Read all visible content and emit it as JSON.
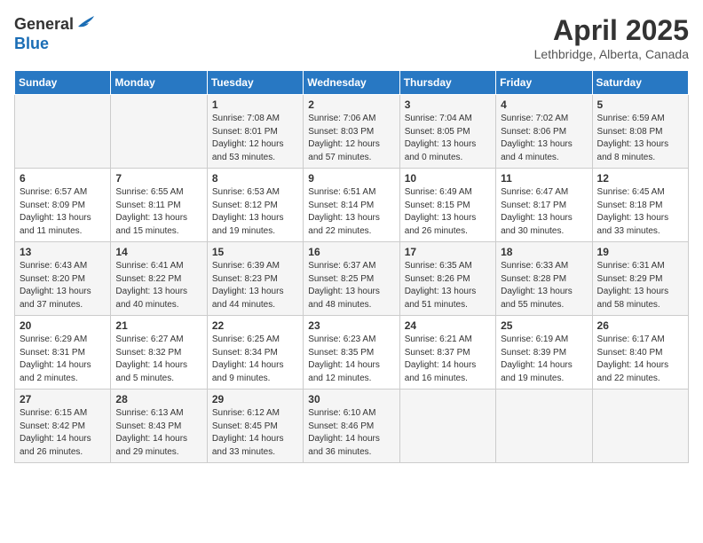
{
  "header": {
    "logo_general": "General",
    "logo_blue": "Blue",
    "month": "April 2025",
    "location": "Lethbridge, Alberta, Canada"
  },
  "days_of_week": [
    "Sunday",
    "Monday",
    "Tuesday",
    "Wednesday",
    "Thursday",
    "Friday",
    "Saturday"
  ],
  "weeks": [
    [
      {
        "day": "",
        "sunrise": "",
        "sunset": "",
        "daylight": ""
      },
      {
        "day": "",
        "sunrise": "",
        "sunset": "",
        "daylight": ""
      },
      {
        "day": "1",
        "sunrise": "Sunrise: 7:08 AM",
        "sunset": "Sunset: 8:01 PM",
        "daylight": "Daylight: 12 hours and 53 minutes."
      },
      {
        "day": "2",
        "sunrise": "Sunrise: 7:06 AM",
        "sunset": "Sunset: 8:03 PM",
        "daylight": "Daylight: 12 hours and 57 minutes."
      },
      {
        "day": "3",
        "sunrise": "Sunrise: 7:04 AM",
        "sunset": "Sunset: 8:05 PM",
        "daylight": "Daylight: 13 hours and 0 minutes."
      },
      {
        "day": "4",
        "sunrise": "Sunrise: 7:02 AM",
        "sunset": "Sunset: 8:06 PM",
        "daylight": "Daylight: 13 hours and 4 minutes."
      },
      {
        "day": "5",
        "sunrise": "Sunrise: 6:59 AM",
        "sunset": "Sunset: 8:08 PM",
        "daylight": "Daylight: 13 hours and 8 minutes."
      }
    ],
    [
      {
        "day": "6",
        "sunrise": "Sunrise: 6:57 AM",
        "sunset": "Sunset: 8:09 PM",
        "daylight": "Daylight: 13 hours and 11 minutes."
      },
      {
        "day": "7",
        "sunrise": "Sunrise: 6:55 AM",
        "sunset": "Sunset: 8:11 PM",
        "daylight": "Daylight: 13 hours and 15 minutes."
      },
      {
        "day": "8",
        "sunrise": "Sunrise: 6:53 AM",
        "sunset": "Sunset: 8:12 PM",
        "daylight": "Daylight: 13 hours and 19 minutes."
      },
      {
        "day": "9",
        "sunrise": "Sunrise: 6:51 AM",
        "sunset": "Sunset: 8:14 PM",
        "daylight": "Daylight: 13 hours and 22 minutes."
      },
      {
        "day": "10",
        "sunrise": "Sunrise: 6:49 AM",
        "sunset": "Sunset: 8:15 PM",
        "daylight": "Daylight: 13 hours and 26 minutes."
      },
      {
        "day": "11",
        "sunrise": "Sunrise: 6:47 AM",
        "sunset": "Sunset: 8:17 PM",
        "daylight": "Daylight: 13 hours and 30 minutes."
      },
      {
        "day": "12",
        "sunrise": "Sunrise: 6:45 AM",
        "sunset": "Sunset: 8:18 PM",
        "daylight": "Daylight: 13 hours and 33 minutes."
      }
    ],
    [
      {
        "day": "13",
        "sunrise": "Sunrise: 6:43 AM",
        "sunset": "Sunset: 8:20 PM",
        "daylight": "Daylight: 13 hours and 37 minutes."
      },
      {
        "day": "14",
        "sunrise": "Sunrise: 6:41 AM",
        "sunset": "Sunset: 8:22 PM",
        "daylight": "Daylight: 13 hours and 40 minutes."
      },
      {
        "day": "15",
        "sunrise": "Sunrise: 6:39 AM",
        "sunset": "Sunset: 8:23 PM",
        "daylight": "Daylight: 13 hours and 44 minutes."
      },
      {
        "day": "16",
        "sunrise": "Sunrise: 6:37 AM",
        "sunset": "Sunset: 8:25 PM",
        "daylight": "Daylight: 13 hours and 48 minutes."
      },
      {
        "day": "17",
        "sunrise": "Sunrise: 6:35 AM",
        "sunset": "Sunset: 8:26 PM",
        "daylight": "Daylight: 13 hours and 51 minutes."
      },
      {
        "day": "18",
        "sunrise": "Sunrise: 6:33 AM",
        "sunset": "Sunset: 8:28 PM",
        "daylight": "Daylight: 13 hours and 55 minutes."
      },
      {
        "day": "19",
        "sunrise": "Sunrise: 6:31 AM",
        "sunset": "Sunset: 8:29 PM",
        "daylight": "Daylight: 13 hours and 58 minutes."
      }
    ],
    [
      {
        "day": "20",
        "sunrise": "Sunrise: 6:29 AM",
        "sunset": "Sunset: 8:31 PM",
        "daylight": "Daylight: 14 hours and 2 minutes."
      },
      {
        "day": "21",
        "sunrise": "Sunrise: 6:27 AM",
        "sunset": "Sunset: 8:32 PM",
        "daylight": "Daylight: 14 hours and 5 minutes."
      },
      {
        "day": "22",
        "sunrise": "Sunrise: 6:25 AM",
        "sunset": "Sunset: 8:34 PM",
        "daylight": "Daylight: 14 hours and 9 minutes."
      },
      {
        "day": "23",
        "sunrise": "Sunrise: 6:23 AM",
        "sunset": "Sunset: 8:35 PM",
        "daylight": "Daylight: 14 hours and 12 minutes."
      },
      {
        "day": "24",
        "sunrise": "Sunrise: 6:21 AM",
        "sunset": "Sunset: 8:37 PM",
        "daylight": "Daylight: 14 hours and 16 minutes."
      },
      {
        "day": "25",
        "sunrise": "Sunrise: 6:19 AM",
        "sunset": "Sunset: 8:39 PM",
        "daylight": "Daylight: 14 hours and 19 minutes."
      },
      {
        "day": "26",
        "sunrise": "Sunrise: 6:17 AM",
        "sunset": "Sunset: 8:40 PM",
        "daylight": "Daylight: 14 hours and 22 minutes."
      }
    ],
    [
      {
        "day": "27",
        "sunrise": "Sunrise: 6:15 AM",
        "sunset": "Sunset: 8:42 PM",
        "daylight": "Daylight: 14 hours and 26 minutes."
      },
      {
        "day": "28",
        "sunrise": "Sunrise: 6:13 AM",
        "sunset": "Sunset: 8:43 PM",
        "daylight": "Daylight: 14 hours and 29 minutes."
      },
      {
        "day": "29",
        "sunrise": "Sunrise: 6:12 AM",
        "sunset": "Sunset: 8:45 PM",
        "daylight": "Daylight: 14 hours and 33 minutes."
      },
      {
        "day": "30",
        "sunrise": "Sunrise: 6:10 AM",
        "sunset": "Sunset: 8:46 PM",
        "daylight": "Daylight: 14 hours and 36 minutes."
      },
      {
        "day": "",
        "sunrise": "",
        "sunset": "",
        "daylight": ""
      },
      {
        "day": "",
        "sunrise": "",
        "sunset": "",
        "daylight": ""
      },
      {
        "day": "",
        "sunrise": "",
        "sunset": "",
        "daylight": ""
      }
    ]
  ]
}
